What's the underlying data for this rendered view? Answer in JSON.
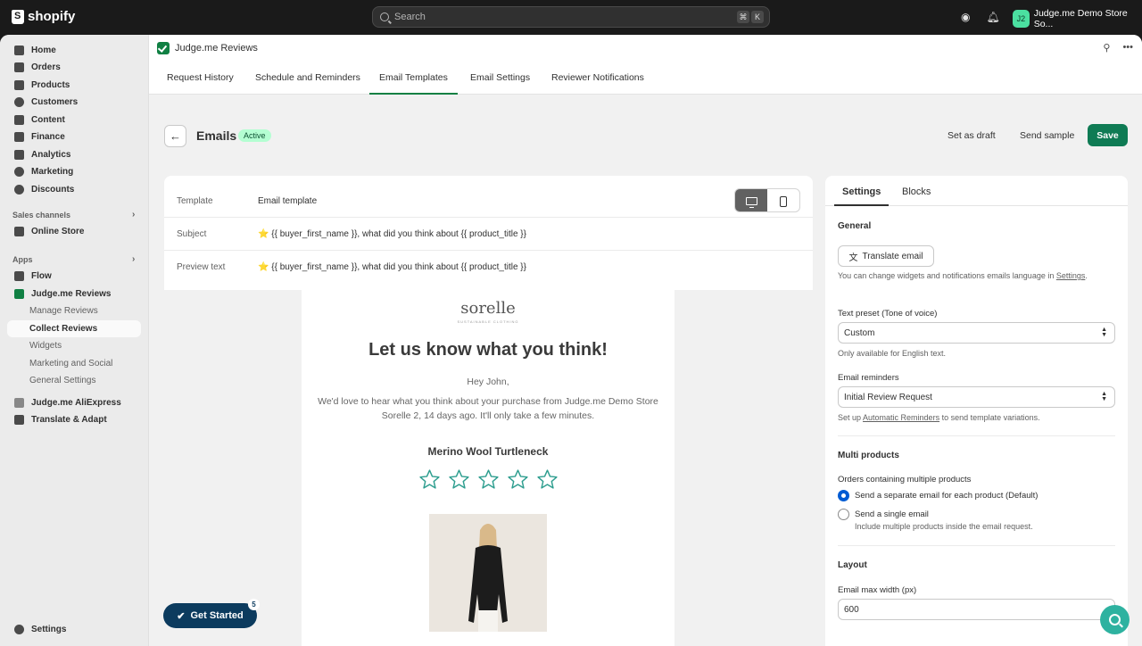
{
  "topbar": {
    "brand": "shopify",
    "search_placeholder": "Search",
    "shortcut_cmd": "⌘",
    "shortcut_key": "K",
    "avatar_initials": "J2",
    "store_name": "Judge.me Demo Store So..."
  },
  "sidebar": {
    "items": [
      {
        "label": "Home",
        "icon": "home-icon"
      },
      {
        "label": "Orders",
        "icon": "orders-icon"
      },
      {
        "label": "Products",
        "icon": "tag-icon"
      },
      {
        "label": "Customers",
        "icon": "person-icon"
      },
      {
        "label": "Content",
        "icon": "content-icon"
      },
      {
        "label": "Finance",
        "icon": "bank-icon"
      },
      {
        "label": "Analytics",
        "icon": "chart-icon"
      },
      {
        "label": "Marketing",
        "icon": "target-icon"
      },
      {
        "label": "Discounts",
        "icon": "discount-icon"
      }
    ],
    "sales_channels_label": "Sales channels",
    "online_store": "Online Store",
    "apps_label": "Apps",
    "flow": "Flow",
    "judgeme": "Judge.me Reviews",
    "sub_items": [
      "Manage Reviews",
      "Collect Reviews",
      "Widgets",
      "Marketing and Social",
      "General Settings"
    ],
    "aliexpress": "Judge.me AliExpress",
    "translate": "Translate & Adapt",
    "settings": "Settings"
  },
  "app": {
    "name": "Judge.me Reviews",
    "tabs": [
      "Request History",
      "Schedule and Reminders",
      "Email Templates",
      "Email Settings",
      "Reviewer Notifications"
    ],
    "active_tab": "Email Templates"
  },
  "page": {
    "title": "Emails",
    "status": "Active",
    "set_as_draft": "Set as draft",
    "send_sample": "Send sample",
    "save": "Save"
  },
  "form": {
    "template_label": "Template",
    "template_value": "Email template",
    "subject_label": "Subject",
    "subject_value": "⭐ {{ buyer_first_name }}, what did you think about {{ product_title }}",
    "preview_label": "Preview text",
    "preview_value": "⭐ {{ buyer_first_name }}, what did you think about {{ product_title }}"
  },
  "email": {
    "brand": "sorelle",
    "brand_sub": "SUSTAINABLE CLOTHING",
    "title": "Let us know what you think!",
    "greeting": "Hey John,",
    "body": "We'd love to hear what you think about your purchase from Judge.me Demo Store Sorelle 2, 14 days ago. It'll only take a few minutes.",
    "product": "Merino Wool Turtleneck",
    "star_count": 5,
    "star_color": "#2e9e8f"
  },
  "settings_panel": {
    "tabs": [
      "Settings",
      "Blocks"
    ],
    "general": "General",
    "translate_btn": "Translate email",
    "translate_help_prefix": "You can change widgets and notifications emails language in ",
    "translate_help_link": "Settings",
    "text_preset_label": "Text preset (Tone of voice)",
    "text_preset_value": "Custom",
    "text_preset_help": "Only available for English text.",
    "reminders_label": "Email reminders",
    "reminders_value": "Initial Review Request",
    "reminders_help_prefix": "Set up ",
    "reminders_help_link": "Automatic Reminders",
    "reminders_help_suffix": " to send template variations.",
    "multi_products": "Multi products",
    "orders_multi_label": "Orders containing multiple products",
    "option_separate": "Send a separate email for each product (Default)",
    "option_single": "Send a single email",
    "option_single_help": "Include multiple products inside the email request.",
    "layout": "Layout",
    "max_width_label": "Email max width (px)",
    "max_width_value": "600"
  },
  "floating": {
    "get_started": "Get Started",
    "get_started_count": "5"
  },
  "colors": {
    "primary_button": "#0f7b54",
    "active_badge_bg": "#b4fed2",
    "get_started_bg": "#0c3b5e",
    "chat_bg": "#2eb2a0"
  }
}
